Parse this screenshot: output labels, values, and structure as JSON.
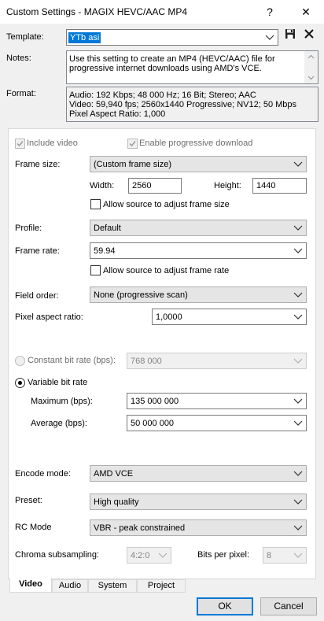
{
  "window": {
    "title": "Custom Settings - MAGIX HEVC/AAC MP4",
    "help": "?",
    "close": "✕"
  },
  "template": {
    "label": "Template:",
    "value": "YTb asi"
  },
  "notes": {
    "label": "Notes:",
    "lines": [
      "Use this setting to create an MP4 (HEVC/AAC) file for",
      "progressive internet downloads using AMD's VCE."
    ]
  },
  "format": {
    "label": "Format:",
    "lines": [
      "Audio: 192 Kbps; 48 000 Hz; 16 Bit; Stereo; AAC",
      "Video: 59,940 fps; 2560x1440 Progressive; NV12; 50 Mbps",
      "Pixel Aspect Ratio: 1,000"
    ]
  },
  "video": {
    "include_video": "Include video",
    "progressive_download": "Enable progressive download",
    "frame_size": {
      "label": "Frame size:",
      "value": "(Custom frame size)"
    },
    "width": {
      "label": "Width:",
      "value": "2560"
    },
    "height": {
      "label": "Height:",
      "value": "1440"
    },
    "allow_frame_size": "Allow source to adjust frame size",
    "profile": {
      "label": "Profile:",
      "value": "Default"
    },
    "frame_rate": {
      "label": "Frame rate:",
      "value": "59.94"
    },
    "allow_frame_rate": "Allow source to adjust frame rate",
    "field_order": {
      "label": "Field order:",
      "value": "None (progressive scan)"
    },
    "pixel_aspect": {
      "label": "Pixel aspect ratio:",
      "value": "1,0000"
    },
    "constant_bit_rate": {
      "label": "Constant bit rate (bps):",
      "value": "768 000"
    },
    "variable_bit_rate": "Variable bit rate",
    "maximum": {
      "label": "Maximum (bps):",
      "value": "135 000 000"
    },
    "average": {
      "label": "Average (bps):",
      "value": "50 000 000"
    },
    "encode_mode": {
      "label": "Encode mode:",
      "value": "AMD VCE"
    },
    "preset": {
      "label": "Preset:",
      "value": "High quality"
    },
    "rc_mode": {
      "label": "RC Mode",
      "value": "VBR - peak constrained"
    },
    "chroma": {
      "label": "Chroma subsampling:",
      "value": "4:2:0"
    },
    "bits_per_pixel": {
      "label": "Bits per pixel:",
      "value": "8"
    }
  },
  "tabs": [
    "Video",
    "Audio",
    "System",
    "Project"
  ],
  "buttons": {
    "ok": "OK",
    "cancel": "Cancel"
  }
}
